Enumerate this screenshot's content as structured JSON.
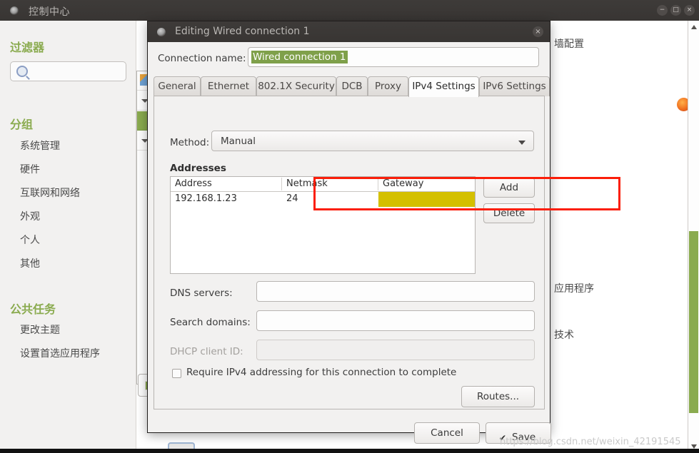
{
  "control_center": {
    "title": "控制中心",
    "window_buttons": [
      {
        "name": "minimize",
        "glyph": "−"
      },
      {
        "name": "maximize",
        "glyph": "□"
      },
      {
        "name": "close",
        "glyph": "×"
      }
    ],
    "sidebar": {
      "filter_heading": "过滤器",
      "search_placeholder": "",
      "search_value": "",
      "group_heading": "分组",
      "group_items": [
        {
          "label": "系统管理"
        },
        {
          "label": "硬件"
        },
        {
          "label": "互联网和网络"
        },
        {
          "label": "外观"
        },
        {
          "label": "个人"
        },
        {
          "label": "其他"
        }
      ],
      "tasks_heading": "公共任务",
      "task_items": [
        {
          "label": "更改主题"
        },
        {
          "label": "设置首选应用程序"
        }
      ]
    },
    "main_partial_texts": [
      {
        "text": "墙配置"
      },
      {
        "text": "应用程序"
      },
      {
        "text": "技术"
      }
    ]
  },
  "dialog": {
    "title": "Editing Wired connection 1",
    "close_glyph": "×",
    "connection_name_label": "Connection name:",
    "connection_name_value": "Wired connection 1",
    "tabs": [
      {
        "label": "General",
        "active": false
      },
      {
        "label": "Ethernet",
        "active": false
      },
      {
        "label": "802.1X Security",
        "active": false
      },
      {
        "label": "DCB",
        "active": false
      },
      {
        "label": "Proxy",
        "active": false
      },
      {
        "label": "IPv4 Settings",
        "active": true
      },
      {
        "label": "IPv6 Settings",
        "active": false
      }
    ],
    "method_label": "Method:",
    "method_value": "Manual",
    "addresses_heading": "Addresses",
    "addresses_table": {
      "columns": [
        "Address",
        "Netmask",
        "Gateway"
      ],
      "rows": [
        {
          "address": "192.168.1.23",
          "netmask": "24",
          "gateway": ""
        }
      ],
      "highlight_color": "#d4c000",
      "outline_color": "#fb1e09"
    },
    "add_button": "Add",
    "delete_button": "Delete",
    "dns_label": "DNS servers:",
    "dns_value": "",
    "search_domains_label": "Search domains:",
    "search_domains_value": "",
    "dhcp_label": "DHCP client ID:",
    "dhcp_value": "",
    "require_ipv4_label": "Require IPv4 addressing for this connection to complete",
    "require_ipv4_checked": false,
    "routes_button": "Routes...",
    "cancel_button": "Cancel",
    "save_button": "Save",
    "save_check_glyph": "✔"
  },
  "watermark": "https://blog.csdn.net/weixin_42191545"
}
